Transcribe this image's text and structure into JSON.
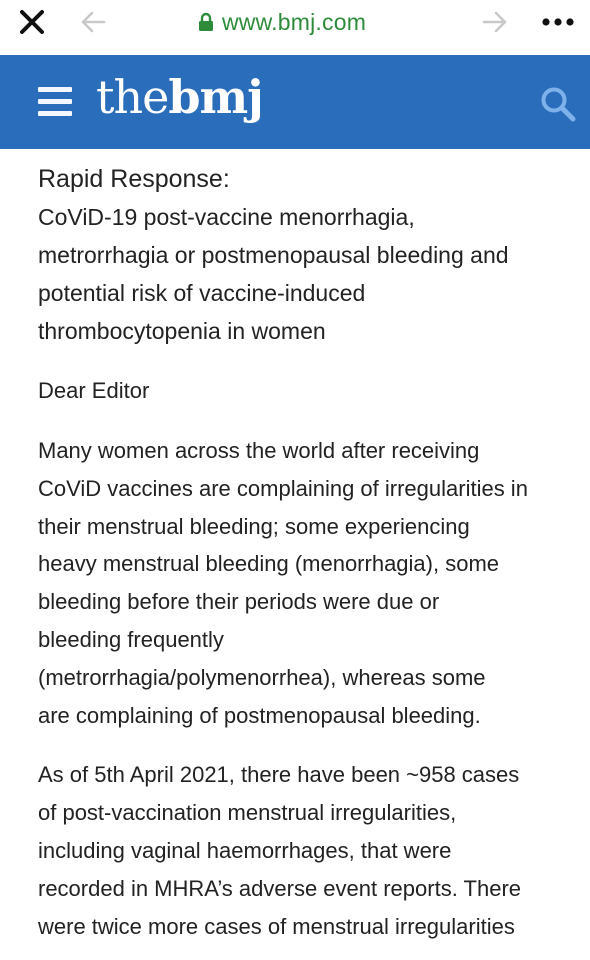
{
  "browser": {
    "url": "www.bmj.com",
    "icons": [
      "close-icon",
      "back-arrow-icon",
      "lock-icon",
      "forward-arrow-icon",
      "more-dots-icon"
    ],
    "url_color": "#2e8b3a"
  },
  "header": {
    "logo_prefix": "the",
    "logo_brand": "bmj",
    "background": "#2a6ebb",
    "icons": [
      "hamburger-menu-icon",
      "search-icon"
    ]
  },
  "article": {
    "kicker": "Rapid Response:",
    "title_lines": [
      "CoViD-19 post-vaccine menorrhagia,",
      "metrorrhagia or postmenopausal bleeding and",
      "potential risk of vaccine-induced",
      "thrombocytopenia in women"
    ],
    "salutation": "Dear Editor",
    "paragraph1_lines": [
      "Many women across the world after receiving",
      "CoViD vaccines are complaining of irregularities in",
      "their menstrual bleeding; some experiencing",
      "heavy menstrual bleeding (menorrhagia), some",
      "bleeding before their periods were due or",
      "bleeding frequently",
      "(metrorrhagia/polymenorrhea), whereas some",
      "are complaining of postmenopausal bleeding."
    ],
    "paragraph2_lines": [
      "As of 5th April 2021, there have been ~958 cases",
      "of post-vaccination menstrual irregularities,",
      "including vaginal haemorrhages, that were",
      "recorded in MHRA’s adverse event reports. There",
      "were twice more cases of menstrual irregularities"
    ]
  }
}
